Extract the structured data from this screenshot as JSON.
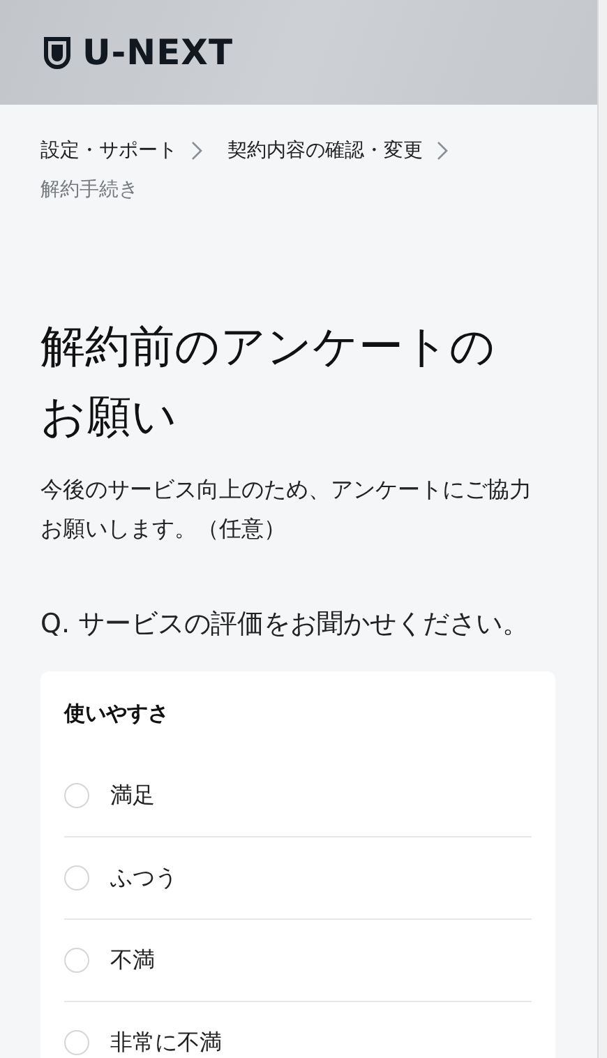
{
  "header": {
    "logo_text": "U-NEXT"
  },
  "breadcrumb": [
    {
      "label": "設定・サポート",
      "current": false
    },
    {
      "label": "契約内容の確認・変更",
      "current": false
    },
    {
      "label": "解約手続き",
      "current": true
    }
  ],
  "title": "解約前のアンケートのお願い",
  "intro": "今後のサービス向上のため、アンケートにご協力お願いします。（任意）",
  "question": "Q. サービスの評価をお聞かせください。",
  "card": {
    "heading": "使いやすさ",
    "options": [
      {
        "label": "満足",
        "selected": false
      },
      {
        "label": "ふつう",
        "selected": false
      },
      {
        "label": "不満",
        "selected": false
      },
      {
        "label": "非常に不満",
        "selected": false
      }
    ]
  }
}
